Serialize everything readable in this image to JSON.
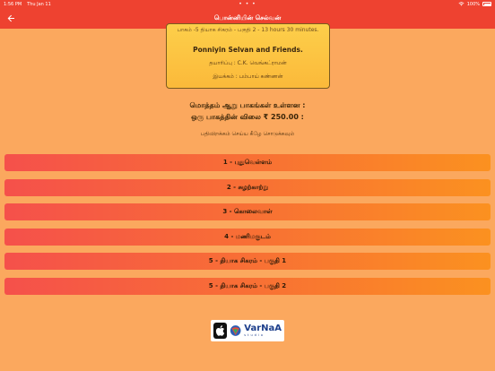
{
  "status": {
    "time": "1:56 PM",
    "date": "Thu Jan 11",
    "dots": "• • •",
    "battery": "100%"
  },
  "header": {
    "title": "பொன்னியின் செல்வன்",
    "back_icon": "arrow-left-icon"
  },
  "card": {
    "duration": "பாகம் -5 தியாக சிகரம் - பகுதி 2 - 13 hours 30 minutes.",
    "cast": "Ponniyin Selvan and Friends.",
    "producer": "தயாரிப்பு : C.K. வெங்கட்ராமன்",
    "director": "இயக்கம் : பம்பாய் கண்ணன்"
  },
  "summary": {
    "total_line": "மொத்தம் ஆறு பாகங்கள் உள்ளன :",
    "price_line": "ஒரு பாகத்தின் விலை ₹ 250.00 :"
  },
  "instruction": "பதிவிறக்கம் செய்ய கீழே சொடுக்கவும்",
  "parts": [
    {
      "label": "1 - புதுவெள்ளம்"
    },
    {
      "label": "2 - சுழற்காற்று"
    },
    {
      "label": "3 - கொலைவாள்"
    },
    {
      "label": "4 - மணிமகுடம்"
    },
    {
      "label": "5 - தியாக சிகரம் - பகுதி 1"
    },
    {
      "label": "5 - தியாக சிகரம் - பகுதி 2"
    }
  ],
  "footer": {
    "brand": "VarNaA",
    "brand_sub": "studio",
    "apple_icon": "apple-logo-icon",
    "logo_icon": "varnaa-logo-icon"
  },
  "colors": {
    "appbar": "#ee4230",
    "background": "#fba85e",
    "card": "#fdcf4a"
  }
}
